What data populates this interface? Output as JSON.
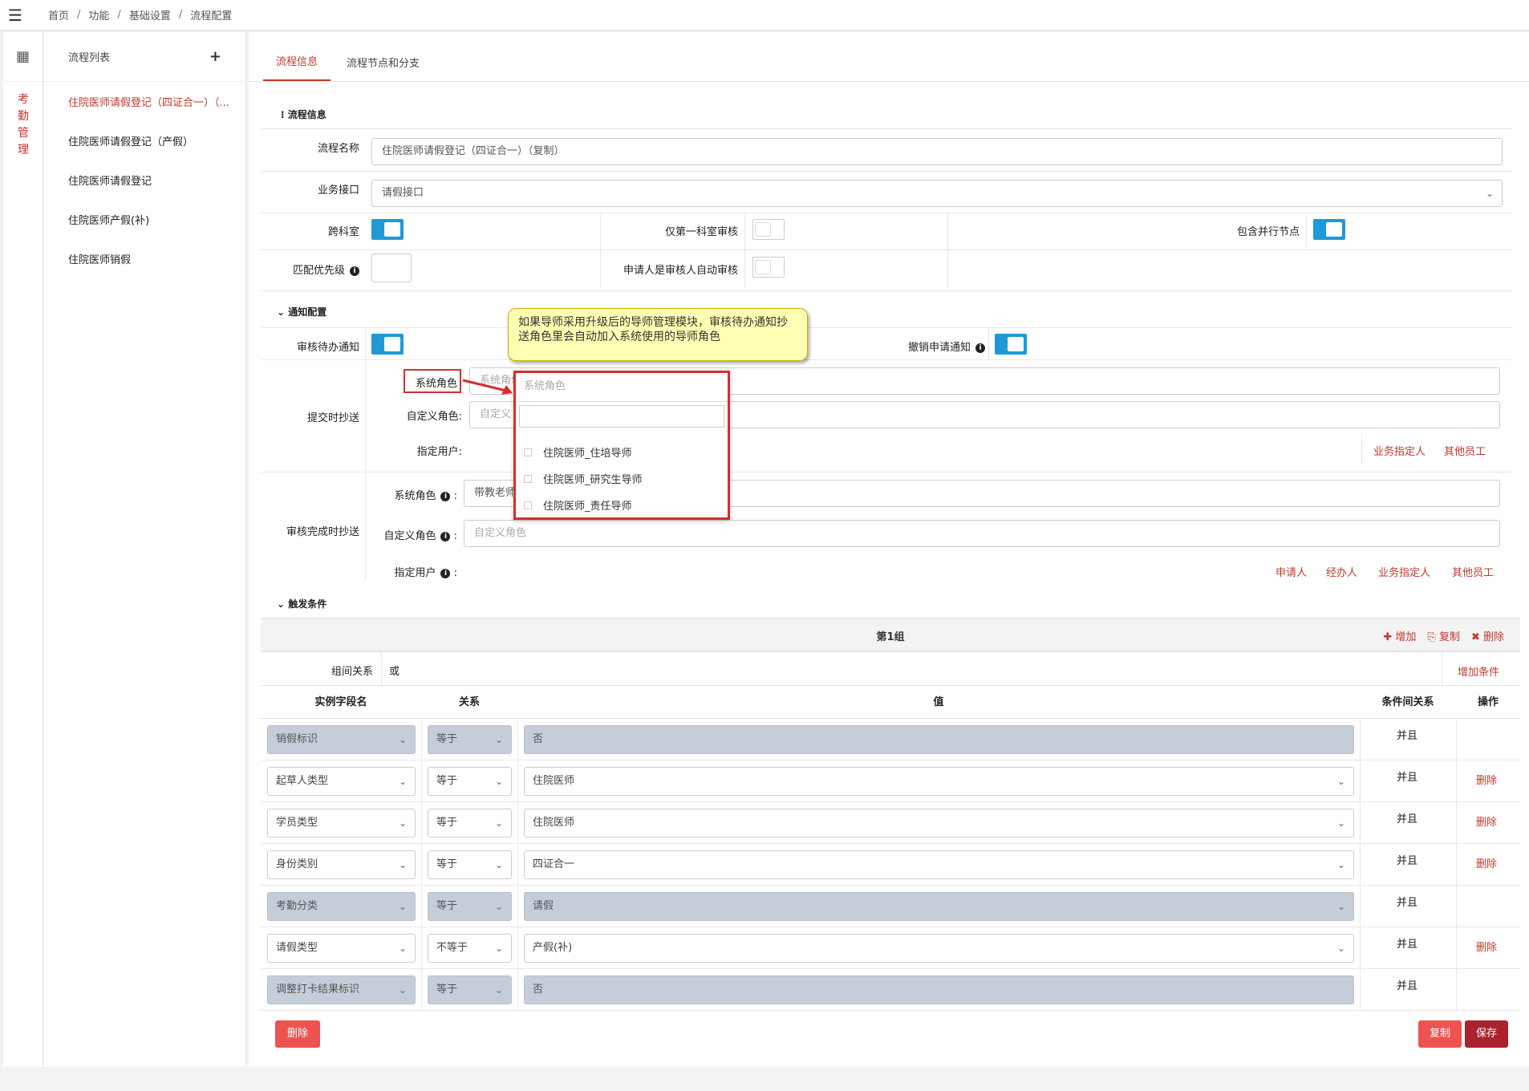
{
  "breadcrumb": [
    "首页",
    "功能",
    "基础设置",
    "流程配置"
  ],
  "sidebar": {
    "module_label": "考勤管理"
  },
  "process_list": {
    "title": "流程列表",
    "items": [
      "住院医师请假登记（四证合一）（...",
      "住院医师请假登记（产假）",
      "住院医师请假登记",
      "住院医师产假(补)",
      "住院医师销假"
    ]
  },
  "tabs": [
    "流程信息",
    "流程节点和分支"
  ],
  "info": {
    "section_title": "流程信息",
    "name_label": "流程名称",
    "name_value": "住院医师请假登记（四证合一）（复制）",
    "api_label": "业务接口",
    "api_value": "请假接口",
    "cross_dept_label": "跨科室",
    "first_dept_only_label": "仅第一科室审核",
    "parallel_label": "包含并行节点",
    "priority_label": "匹配优先级",
    "auto_audit_label": "申请人是审核人自动审核"
  },
  "notify": {
    "section_title": "通知配置",
    "pending_label": "审核待办通知",
    "cancel_label": "撤销申请通知",
    "submit_cc_label": "提交时抄送",
    "sys_role_label": "系统角色",
    "sys_role_placeholder": "系统角色",
    "custom_role_label": "自定义角色:",
    "custom_role_placeholder": "自定义",
    "assign_user_label": "指定用户:",
    "links_submit": [
      "业务指定人",
      "其他员工"
    ],
    "complete_cc_label": "审核完成时抄送",
    "complete_sys_role_label": "系统角色",
    "complete_sys_role_value": "带教老师",
    "complete_custom_role_label": "自定义角色",
    "complete_custom_role_placeholder": "自定义角色",
    "complete_assign_user_label": "指定用户",
    "links_complete": [
      "申请人",
      "经办人",
      "业务指定人",
      "其他员工"
    ]
  },
  "callout": {
    "text": "如果导师采用升级后的导师管理模块，审核待办通知抄送角色里会自动加入系统使用的导师角色"
  },
  "dropdown": {
    "header": "系统角色",
    "options": [
      "住院医师_住培导师",
      "住院医师_研究生导师",
      "住院医师_责任导师"
    ]
  },
  "trigger": {
    "section_title": "触发条件",
    "group_title": "第1组",
    "actions": [
      "增加",
      "复制",
      "删除"
    ],
    "group_relation_label": "组间关系",
    "group_relation_value": "或",
    "add_condition": "增加条件",
    "columns": [
      "实例字段名",
      "关系",
      "值",
      "条件间关系",
      "操作"
    ],
    "rows": [
      {
        "field": "销假标识",
        "op": "等于",
        "value": "否",
        "rel": "并且",
        "action": "",
        "disabled": true,
        "value_select": false
      },
      {
        "field": "起草人类型",
        "op": "等于",
        "value": "住院医师",
        "rel": "并且",
        "action": "删除",
        "disabled": false,
        "value_select": true
      },
      {
        "field": "学员类型",
        "op": "等于",
        "value": "住院医师",
        "rel": "并且",
        "action": "删除",
        "disabled": false,
        "value_select": true
      },
      {
        "field": "身份类别",
        "op": "等于",
        "value": "四证合一",
        "rel": "并且",
        "action": "删除",
        "disabled": false,
        "value_select": true
      },
      {
        "field": "考勤分类",
        "op": "等于",
        "value": "请假",
        "rel": "并且",
        "action": "",
        "disabled": true,
        "value_select": true
      },
      {
        "field": "请假类型",
        "op": "不等于",
        "value": "产假(补)",
        "rel": "并且",
        "action": "删除",
        "disabled": false,
        "value_select": true
      },
      {
        "field": "调整打卡结果标识",
        "op": "等于",
        "value": "否",
        "rel": "并且",
        "action": "",
        "disabled": true,
        "value_select": false
      }
    ]
  },
  "buttons": {
    "delete": "删除",
    "copy": "复制",
    "save": "保存"
  },
  "colors": {
    "accent": "#c0392b",
    "toggle_on": "#1e9ad6",
    "save": "#a8232e",
    "danger": "#ef5350"
  }
}
